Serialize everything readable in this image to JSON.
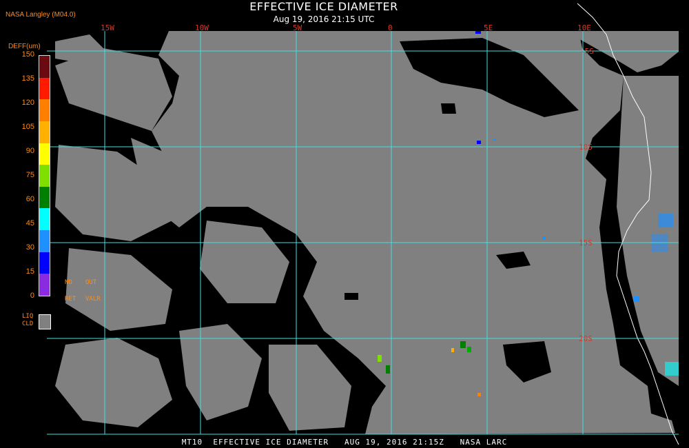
{
  "header": {
    "producer": "NASA Langley (M04.0)",
    "title": "EFFECTIVE ICE DIAMETER",
    "subtitle": "Aug 19, 2016 21:15 UTC"
  },
  "footer": {
    "caption": "MT10  EFFECTIVE ICE DIAMETER   AUG 19, 2016 21:15Z   NASA LARC"
  },
  "legend": {
    "title": "DEFF(um)",
    "ticks": [
      "150",
      "135",
      "120",
      "105",
      "90",
      "75",
      "60",
      "45",
      "30",
      "15",
      "0"
    ],
    "colors": [
      "#6b0a10",
      "#ff1a00",
      "#ff7f00",
      "#ffb000",
      "#ffff00",
      "#7fe000",
      "#008000",
      "#00ffff",
      "#1e90ff",
      "#0000ff",
      "#8a2be2"
    ],
    "categories": {
      "no": "NO",
      "out": "OUT",
      "ret": "RET",
      "valr": "VALR"
    },
    "liquid_label_1": "LIQ",
    "liquid_label_2": "CLD",
    "liquid_color": "#808080"
  },
  "map": {
    "grid_color": "#40e0e0",
    "coast_color": "#ffffff",
    "label_color": "#d63a2a",
    "lon_labels": [
      {
        "id": "15w",
        "text": "15W"
      },
      {
        "id": "10w",
        "text": "10W"
      },
      {
        "id": "5w",
        "text": "5W"
      },
      {
        "id": "0",
        "text": "0"
      },
      {
        "id": "5e",
        "text": "5E"
      },
      {
        "id": "10e",
        "text": "10E"
      }
    ],
    "lat_labels": [
      {
        "id": "5s",
        "text": "-5S"
      },
      {
        "id": "10s",
        "text": "10S"
      },
      {
        "id": "15s",
        "text": "15S"
      },
      {
        "id": "20s",
        "text": "20S"
      }
    ]
  }
}
